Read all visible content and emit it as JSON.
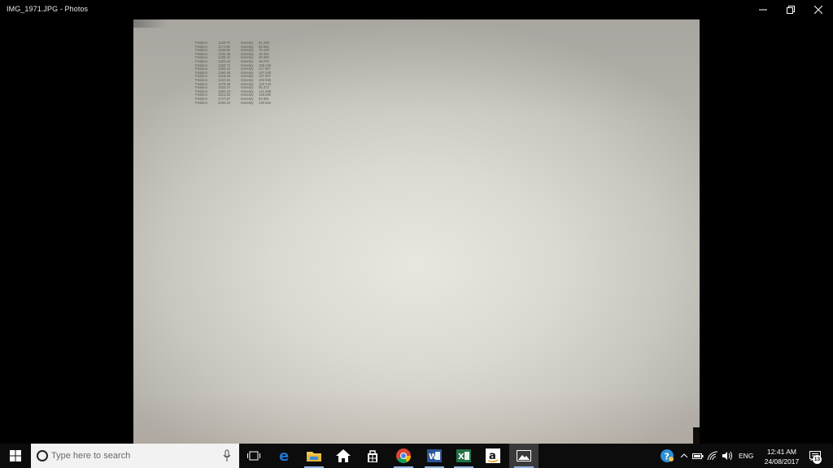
{
  "window": {
    "title": "IMG_1971.JPG - Photos",
    "controls": [
      "minimize",
      "restore",
      "close"
    ]
  },
  "photo": {
    "readings": [
      {
        "label": "Position",
        "position": "1149.76",
        "metric": "Intensity",
        "value": "51.236"
      },
      {
        "label": "Position",
        "position": "1174.96",
        "metric": "Intensity",
        "value": "58.652"
      },
      {
        "label": "Position",
        "position": "1198.86",
        "metric": "Intensity",
        "value": "70.130"
      },
      {
        "label": "Position",
        "position": "1233.45",
        "metric": "Intensity",
        "value": "16.401"
      },
      {
        "label": "Position",
        "position": "1235.41",
        "metric": "Intensity",
        "value": "38.294"
      },
      {
        "label": "Position",
        "position": "1322.44",
        "metric": "Intensity",
        "value": "48.070"
      },
      {
        "label": "Position",
        "position": "1349.71",
        "metric": "Intensity",
        "value": "109.159"
      },
      {
        "label": "Position",
        "position": "1363.23",
        "metric": "Intensity",
        "value": "117.007"
      },
      {
        "label": "Position",
        "position": "1390.46",
        "metric": "Intensity",
        "value": "107.040"
      },
      {
        "label": "Position",
        "position": "1416.63",
        "metric": "Intensity",
        "value": "107.907"
      },
      {
        "label": "Position",
        "position": "1442.94",
        "metric": "Intensity",
        "value": "102.565"
      },
      {
        "label": "Position",
        "position": "1478.25",
        "metric": "Intensity",
        "value": "125.743"
      },
      {
        "label": "Position",
        "position": "1534.47",
        "metric": "Intensity",
        "value": "95.373"
      },
      {
        "label": "Position",
        "position": "1582.23",
        "metric": "Intensity",
        "value": "121.699"
      },
      {
        "label": "Position",
        "position": "1612.52",
        "metric": "Intensity",
        "value": "129.082"
      },
      {
        "label": "Position",
        "position": "1727.57",
        "metric": "Intensity",
        "value": "92.991"
      },
      {
        "label": "Position",
        "position": "2093.10",
        "metric": "Intensity",
        "value": "130.564"
      }
    ]
  },
  "taskbar": {
    "search_placeholder": "Type here to search",
    "apps": [
      {
        "name": "task-view",
        "icon": "task-view-icon"
      },
      {
        "name": "edge",
        "icon": "edge-icon"
      },
      {
        "name": "file-explorer",
        "icon": "folder-icon"
      },
      {
        "name": "home",
        "icon": "home-icon"
      },
      {
        "name": "store",
        "icon": "store-icon"
      },
      {
        "name": "chrome",
        "icon": "chrome-icon"
      },
      {
        "name": "word",
        "icon": "word-icon"
      },
      {
        "name": "excel",
        "icon": "excel-icon"
      },
      {
        "name": "amazon",
        "icon": "amazon-icon"
      },
      {
        "name": "photos",
        "icon": "photos-icon",
        "active": true
      }
    ],
    "tray": {
      "language": "ENG",
      "time": "12:41 AM",
      "date": "24/08/2017",
      "notification_count": "13"
    }
  },
  "colors": {
    "taskbar_bg": "#0c0c0c",
    "search_bg": "#f2f2f2",
    "edge_blue": "#1e73d0",
    "word_blue": "#2b579a",
    "excel_green": "#217346",
    "folder_yellow": "#f3c64c",
    "active_underline": "#8fb3e0"
  }
}
